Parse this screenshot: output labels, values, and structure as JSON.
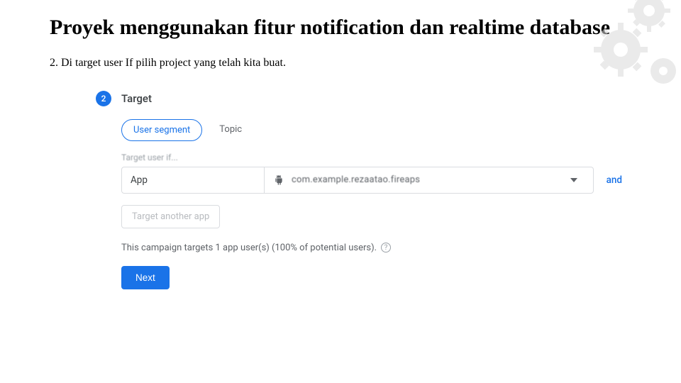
{
  "slide": {
    "title": "Proyek menggunakan fitur notification dan realtime database",
    "body_text": "2. Di target user If pilih project yang telah kita buat."
  },
  "step": {
    "number": "2",
    "title": "Target"
  },
  "tabs": {
    "user_segment": "User segment",
    "topic": "Topic"
  },
  "target": {
    "label": "Target user if...",
    "field_label": "App",
    "app_name": "com.example.rezaatao.fireaps",
    "and": "and",
    "another_app": "Target another app"
  },
  "summary": {
    "text": "This campaign targets 1 app user(s) (100% of potential users)."
  },
  "actions": {
    "next": "Next"
  }
}
